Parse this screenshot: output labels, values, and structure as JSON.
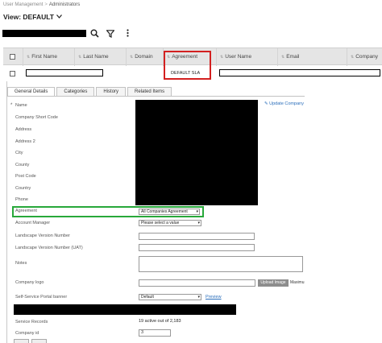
{
  "breadcrumb": {
    "parent": "User Management",
    "separator": ">",
    "current": "Administrators"
  },
  "view": {
    "title": "View: DEFAULT"
  },
  "grid": {
    "columns": [
      "First Name",
      "Last Name",
      "Domain",
      "Agreement",
      "User Name",
      "Email",
      "Company"
    ],
    "row": {
      "agreement": "DEFAULT SLA"
    }
  },
  "tabs": [
    "General Details",
    "Categories",
    "History",
    "Related Items"
  ],
  "form": {
    "update_link": "Update Company",
    "labels": {
      "name": "Name",
      "short_code": "Company Short Code",
      "address": "Address",
      "address2": "Address 2",
      "city": "City",
      "county": "County",
      "post_code": "Post Code",
      "country": "Country",
      "phone": "Phone",
      "agreement": "Agreement",
      "account_manager": "Account Manager",
      "landscape_version": "Landscape Version Number",
      "landscape_version_uat": "Landscape Version Number (UAT)",
      "notes": "Notes",
      "logo": "Company logo",
      "ssp_banner": "Self-Service Portal banner",
      "service_records": "Service Records",
      "company_id": "Company id"
    },
    "agreement_value": "All Companies Agreement",
    "account_manager_value": "Please select a value",
    "upload_button": "Upload Image",
    "upload_hint": "Maximu",
    "ssp_banner_value": "Default",
    "preview_link": "Preview",
    "service_records_value": "19 active out of 2,183",
    "company_id_value": "3"
  },
  "colors": {
    "highlight_red": "#d32020",
    "highlight_green": "#28a83a",
    "link": "#2a6ebb"
  }
}
